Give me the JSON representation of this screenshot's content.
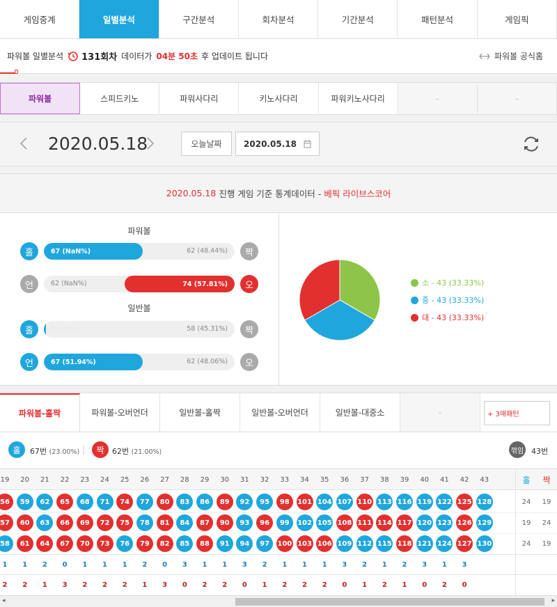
{
  "top_tabs": [
    "게임중계",
    "일별분석",
    "구간분석",
    "회차분석",
    "기간분석",
    "패턴분석",
    "게임픽"
  ],
  "info": {
    "prefix": "파워볼 일별분석",
    "round": "131회차",
    "mid": "데이터가",
    "time": "04분 50초",
    "suffix": "후 업데이트 됩니다",
    "home": "파워볼 공식홈"
  },
  "games": [
    "파워볼",
    "스피드키노",
    "파워사다리",
    "키노사다리",
    "파워키노사다리",
    "-",
    "-"
  ],
  "date": {
    "current": "2020.05.18",
    "today_btn": "오늘날짜",
    "picker": "2020.05.18"
  },
  "stat_head": {
    "date": "2020.05.18",
    "text": "진행 게임 기준 통계데이터 -",
    "brand": "베픽 라이브스코어"
  },
  "powerball": {
    "title": "파워볼",
    "rows": [
      {
        "left": "홀",
        "right": "짝",
        "left_label": "67 (NaN%)",
        "right_label": "62 (48.44%)",
        "left_frac": 0.52,
        "right_frac": 0,
        "left_color": "#1fa6dd",
        "right_color": "#aaaaaa"
      },
      {
        "left": "언",
        "right": "오",
        "left_label": "62 (NaN%)",
        "right_label": "74 (57.81%)",
        "left_frac": 0,
        "right_frac": 0.578,
        "left_color": "#aaaaaa",
        "right_color": "#e2302f"
      }
    ]
  },
  "normal": {
    "title": "일반볼",
    "rows": [
      {
        "left": "홀",
        "right": "짝",
        "left_label": "70 (0%)",
        "right_label": "58 (45.31%)",
        "left_frac": 0.01,
        "right_frac": 0,
        "left_color": "#1fa6dd",
        "right_color": "#aaaaaa"
      },
      {
        "left": "언",
        "right": "오",
        "left_label": "67 (51.94%)",
        "right_label": "62 (48.06%)",
        "left_frac": 0.52,
        "right_frac": 0,
        "left_color": "#1fa6dd",
        "right_color": "#aaaaaa"
      }
    ]
  },
  "chart_data": {
    "type": "pie",
    "labels": [
      "소",
      "중",
      "대"
    ],
    "values": [
      43,
      43,
      43
    ],
    "percent_labels": [
      "43 (33.33%)",
      "43 (33.33%)",
      "43 (33.33%)"
    ],
    "colors": [
      "#8ec549",
      "#1fa6dd",
      "#e2302f"
    ]
  },
  "pattern_tabs": [
    "파워볼-홀짝",
    "파워볼-오버언더",
    "일반볼-홀짝",
    "일반볼-오버언더",
    "일반볼-대중소",
    "-"
  ],
  "pattern_select": "+ 3매패턴",
  "summary": {
    "odd": "홀",
    "odd_count": "67번",
    "odd_pct": "(23.00%)",
    "even": "짝",
    "even_count": "62번",
    "even_pct": "(21.00%)",
    "break": "꺾임",
    "break_count": "43번"
  },
  "grid": {
    "columns": [
      "19",
      "20",
      "21",
      "22",
      "23",
      "24",
      "25",
      "26",
      "27",
      "28",
      "29",
      "30",
      "31",
      "32",
      "33",
      "34",
      "35",
      "36",
      "37",
      "38",
      "39",
      "40",
      "41",
      "42",
      "43"
    ],
    "odd_head": "홀",
    "even_head": "짝",
    "rows": [
      [
        "56",
        "59",
        "62",
        "65",
        "68",
        "71",
        "74",
        "77",
        "80",
        "83",
        "86",
        "89",
        "92",
        "95",
        "98",
        "101",
        "104",
        "107",
        "110",
        "113",
        "116",
        "119",
        "122",
        "125",
        "128"
      ],
      [
        "57",
        "60",
        "63",
        "66",
        "69",
        "72",
        "75",
        "78",
        "81",
        "84",
        "87",
        "90",
        "93",
        "96",
        "99",
        "102",
        "105",
        "108",
        "111",
        "114",
        "117",
        "120",
        "123",
        "126",
        "129"
      ],
      [
        "58",
        "61",
        "64",
        "67",
        "70",
        "73",
        "76",
        "79",
        "82",
        "85",
        "88",
        "91",
        "94",
        "97",
        "100",
        "103",
        "106",
        "109",
        "112",
        "115",
        "118",
        "121",
        "124",
        "127",
        "130"
      ]
    ],
    "colors": [
      "RBBRBBRBRBBRBBRRBBRBBBBRB",
      "RRBRRRRBRBRRBRBBBRRRRBBRB",
      "BRRRRRBRRBRBBBRRRBBBRBBRB"
    ],
    "row_tot": [
      [
        "24",
        "19"
      ],
      [
        "19",
        "24"
      ],
      [
        "24",
        "19"
      ]
    ],
    "count1": [
      "1",
      "1",
      "2",
      "0",
      "1",
      "1",
      "1",
      "2",
      "0",
      "3",
      "1",
      "1",
      "3",
      "2",
      "1",
      "1",
      "1",
      "3",
      "2",
      "1",
      "2",
      "3",
      "1",
      "3",
      ""
    ],
    "count2": [
      "2",
      "2",
      "1",
      "3",
      "2",
      "2",
      "2",
      "1",
      "3",
      "0",
      "2",
      "2",
      "0",
      "1",
      "2",
      "2",
      "2",
      "0",
      "1",
      "2",
      "1",
      "0",
      "2",
      "0",
      ""
    ]
  },
  "palette": {
    "blue": "#1fa6dd",
    "red": "#e2302f",
    "gray": "#aaaaaa",
    "green": "#8ec549"
  }
}
